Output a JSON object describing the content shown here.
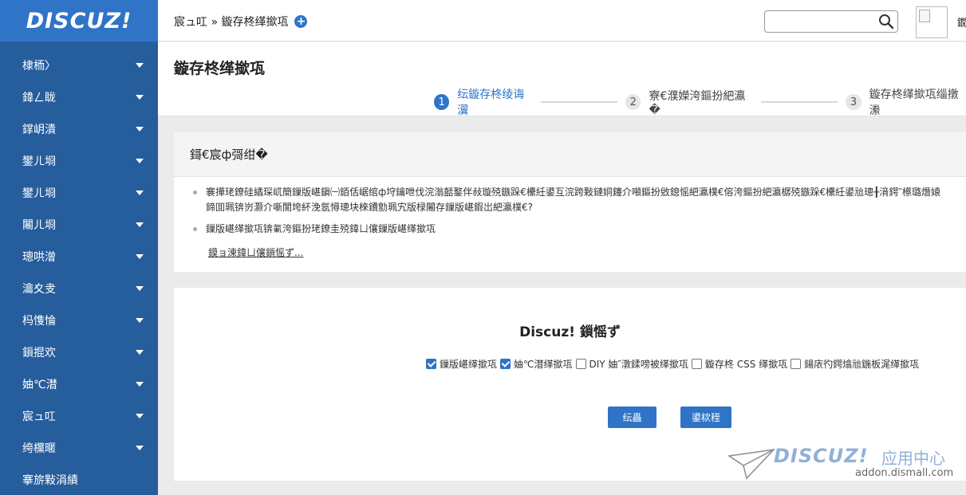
{
  "brand": {
    "logo_text": "DISCUZ!"
  },
  "sidebar": {
    "items": [
      {
        "label": "棣栭〉",
        "icon": "chevron-down-icon"
      },
      {
        "label": "鍏ㄥ眬",
        "icon": "chevron-down-icon"
      },
      {
        "label": "鐣岄潰",
        "icon": "chevron-down-icon"
      },
      {
        "label": "鐢ㄦ埛",
        "icon": "chevron-down-icon"
      },
      {
        "label": "鐢ㄦ埛",
        "icon": "chevron-down-icon"
      },
      {
        "label": "闂ㄦ埛",
        "icon": "chevron-down-icon"
      },
      {
        "label": "璁哄潧",
        "icon": "chevron-down-icon"
      },
      {
        "label": "瀹夊叏",
        "icon": "chevron-down-icon"
      },
      {
        "label": "杩愯惀",
        "icon": "chevron-down-icon"
      },
      {
        "label": "鎻掍欢",
        "icon": "chevron-down-icon"
      },
      {
        "label": "妯℃澘",
        "icon": "chevron-down-icon"
      },
      {
        "label": "宸ュ叿",
        "icon": "chevron-down-icon"
      },
      {
        "label": "绔欓暱",
        "icon": "chevron-down-icon"
      },
      {
        "label": "搴旂敤涓績",
        "icon": ""
      }
    ]
  },
  "header": {
    "breadcrumb": "宸ュ叿 » 鏇存柊缂撳瓨",
    "search_placeholder": "",
    "user_name": "鐗"
  },
  "page": {
    "title": "鏇存柊缂撳瓨",
    "steps": [
      {
        "num": "1",
        "label": "纭鏇存柊绫诲瀷",
        "active": true
      },
      {
        "num": "2",
        "label": "寮€濮嬫洿鏂扮紦瀛�",
        "active": false
      },
      {
        "num": "3",
        "label": "鏇存柊缂撳瓨缁撴潫",
        "active": false
      }
    ]
  },
  "notice": {
    "title": "鎶€宸ф彁绀�",
    "tips": [
      "褰撶珯鐐硅繘琛屼簡鏁版嵁鎭㈠銆佸崌绾ф垨鑰呭伐浣滃嚭鐜伴敊璇殑鏃跺€欙紝鍙互浣跨敤鏈姛鑳介噸鏂扮敓鎴愮紦瀛樸€傛洿鏂扮紦瀛樼殑鏃跺€欙紝鍙兘璁╂湇鍔″櫒璐熸媴鍗囬珮锛岃灏介噺閬垮紑浼氬憳璁块棶鐨勯珮宄版椂闂存鏁版嵁鍜岀紦瀛樸€?",
      "鏁版嵁缂撳瓨锛氭洿鏂扮珯鐐圭殑鍏ㄩ儴鏁版嵁缂撳瓨"
    ],
    "more_link": "鏌ョ湅鍏ㄩ儴鎻愮ず..."
  },
  "backup": {
    "title": "Discuz! 鎻愮ず",
    "options": [
      {
        "label": "鏁版嵁缂撳瓨",
        "checked": true
      },
      {
        "label": "妯℃澘缂撳瓨",
        "checked": true
      },
      {
        "label": "DIY 妯″潡鍒嗙被缂撳瓨",
        "checked": false
      },
      {
        "label": "鏇存柊 CSS 缂撳瓨",
        "checked": false
      },
      {
        "label": "鍚庡彴鍔熻兘鍦板浘缂撳瓨",
        "checked": false
      }
    ],
    "confirm_label": "纭畾",
    "cancel_label": "鍙栨秷"
  },
  "watermark": {
    "brand": "DISCUZ!",
    "cn": "应用中心",
    "url": "addon.dismall.com"
  },
  "colors": {
    "sidebar_bg": "#265d9d",
    "logo_bg": "#2f74c7",
    "accent": "#2f74c7"
  }
}
